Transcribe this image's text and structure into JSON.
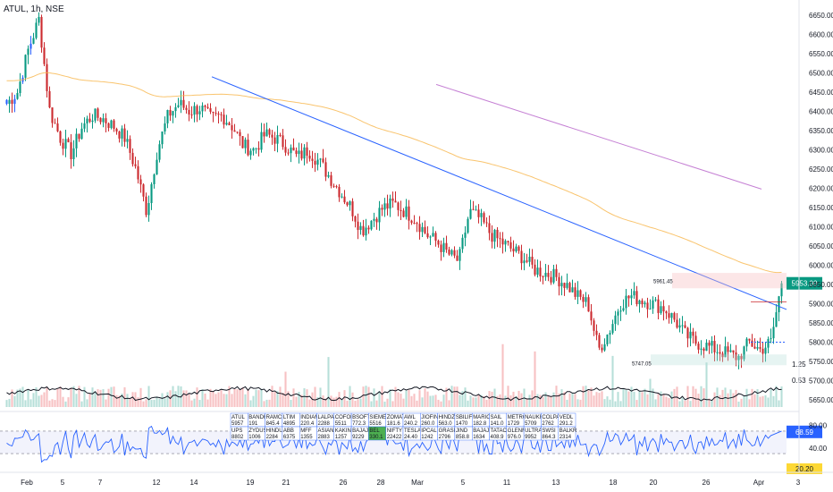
{
  "header": {
    "symbol_title": "ATUL, 1h, NSE"
  },
  "colors": {
    "up": "#089981",
    "down": "#cc2a2f",
    "blue_candle": "#2962ff",
    "vol_up": "#b7dfd9",
    "vol_down": "#f7c1c3",
    "ema_orange": "#f7b54a",
    "ema_purple": "#c580d4",
    "trendline": "#2962ff",
    "rsi": "#2962ff",
    "price_badge": "#089981",
    "rsi_badge": "#2962ff"
  },
  "price_axis": {
    "ticks": [
      "6650.00",
      "6600.00",
      "6550.00",
      "6500.00",
      "6450.00",
      "6400.00",
      "6350.00",
      "6300.00",
      "6250.00",
      "6200.00",
      "6150.00",
      "6100.00",
      "6050.00",
      "6000.00",
      "5950.00",
      "5900.00",
      "5850.00",
      "5800.00",
      "5750.00",
      "5700.00",
      "5650.00"
    ],
    "current_price": "5953.00",
    "ratio_1": "1.25",
    "ratio_2": "0.53"
  },
  "rsi_axis": {
    "ticks": [
      "80.00",
      "40.00"
    ],
    "current": "68.59",
    "low": "20.20"
  },
  "time_axis": {
    "labels": [
      "Feb",
      "5",
      "7",
      "12",
      "14",
      "19",
      "21",
      "26",
      "28",
      "Mar",
      "5",
      "11",
      "13",
      "18",
      "20",
      "26",
      "Apr",
      "3"
    ]
  },
  "annotations": {
    "high_label": "5961.45",
    "low_label": "5747.05"
  },
  "watchlist": {
    "row1": [
      "ATUL",
      "BANDHA",
      "RAMCO",
      "LTIM",
      "INDIAM",
      "LALPAT",
      "COFORGE",
      "BSOFT",
      "SIEMENS",
      "ZOMATO",
      "AWL",
      "JIOFIN",
      "HINDZ",
      "SBILIFE",
      "MARICO",
      "SAIL",
      "METRO",
      "NAUKRI",
      "COLPAL",
      "VEDL"
    ],
    "row1v": [
      "5957",
      "191",
      "845.4",
      "4895",
      "220.4",
      "2288",
      "5511",
      "772.3",
      "5516",
      "181.6",
      "240.2",
      "260.0",
      "563.0",
      "1470",
      "182.8",
      "141.0",
      "1729",
      "5709",
      "2762",
      "291.2"
    ],
    "row2": [
      "UPS",
      "ZYDUS",
      "HINDU",
      "ABB",
      "MFF",
      "ASIAN",
      "KAKIN",
      "BAJAJ",
      "BEL",
      "NIFTY",
      "TESLA",
      "IPCAL",
      "GRASI",
      "JIND",
      "BAJAJ",
      "TATAC",
      "GLENM",
      "ULTRA",
      "SWSI",
      "BALKR"
    ],
    "row2v": [
      "8802",
      "1006",
      "2284",
      "6375",
      "1355",
      "2883",
      "1257",
      "9229",
      "330.1",
      "22422",
      "24.40",
      "1242",
      "2796",
      "858.8",
      "1634",
      "408.9",
      "976.0",
      "9952",
      "864.3",
      "2314"
    ],
    "highlight_row2_index": 8
  },
  "chart_data": [
    {
      "type": "candlestick",
      "title": "ATUL, 1h, NSE",
      "ylim": [
        5635,
        6680
      ],
      "x_labels": [
        "Feb",
        "5",
        "7",
        "12",
        "14",
        "19",
        "21",
        "26",
        "28",
        "Mar",
        "5",
        "11",
        "13",
        "18",
        "20",
        "26",
        "Apr",
        "3"
      ],
      "close_path": [
        6420,
        6450,
        6560,
        6640,
        6400,
        6330,
        6290,
        6360,
        6390,
        6380,
        6360,
        6330,
        6250,
        6140,
        6300,
        6390,
        6420,
        6400,
        6410,
        6380,
        6390,
        6360,
        6310,
        6300,
        6340,
        6330,
        6310,
        6280,
        6300,
        6270,
        6230,
        6190,
        6150,
        6090,
        6120,
        6150,
        6160,
        6140,
        6120,
        6080,
        6060,
        6030,
        6010,
        6140,
        6120,
        6080,
        6060,
        6040,
        6020,
        5990,
        5980,
        5970,
        5950,
        5920,
        5900,
        5780,
        5830,
        5900,
        5920,
        5910,
        5900,
        5890,
        5860,
        5820,
        5800,
        5790,
        5780,
        5770,
        5760,
        5800,
        5780,
        5800,
        5953
      ],
      "volume_last": 1.25,
      "annotations": [
        {
          "label": "5961.45",
          "type": "swing high"
        },
        {
          "label": "5747.05",
          "type": "swing low"
        }
      ],
      "ema_purple": [
        [
          0.52,
          6470
        ],
        [
          0.93,
          6200
        ]
      ],
      "trendline": [
        [
          0.25,
          6490
        ],
        [
          0.96,
          5885
        ]
      ]
    },
    {
      "type": "line",
      "name": "RSI",
      "ylim": [
        0,
        100
      ],
      "levels": [
        70,
        30
      ],
      "current": 68.59,
      "low": 20.2
    }
  ]
}
